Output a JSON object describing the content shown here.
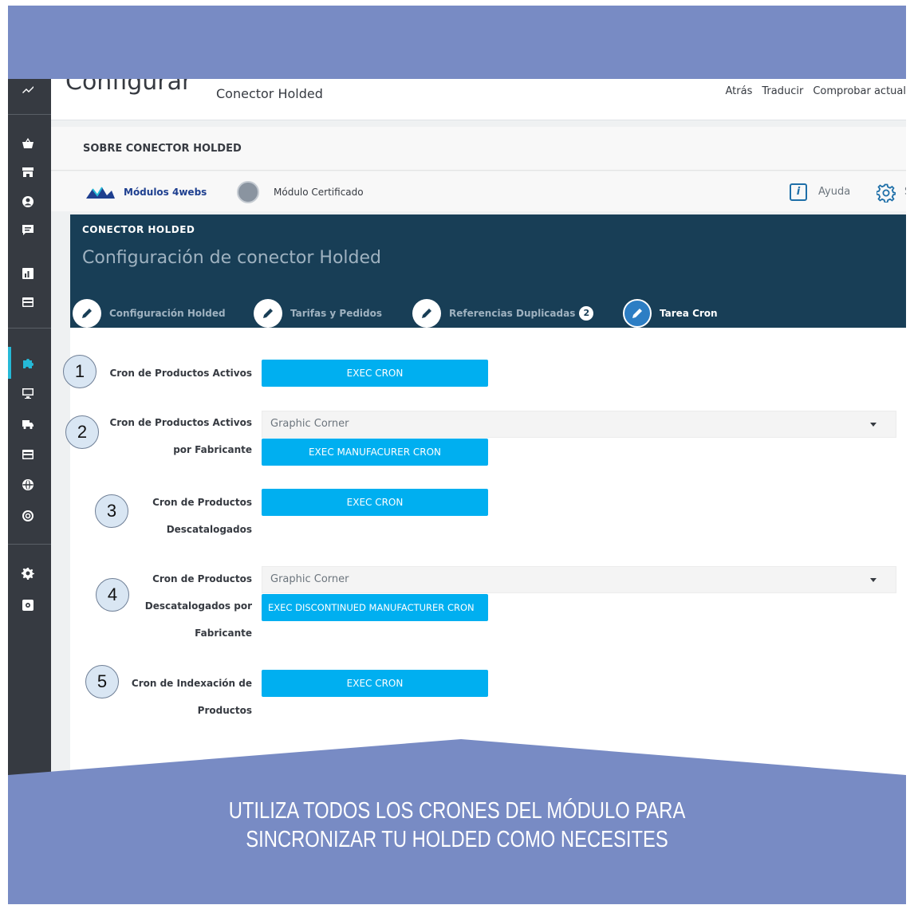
{
  "header": {
    "page_title": "Configurar",
    "module_name": "Conector Holded",
    "links": [
      "Atrás",
      "Traducir",
      "Comprobar actual"
    ]
  },
  "about": {
    "title": "SOBRE CONECTOR HOLDED"
  },
  "module_bar": {
    "brand_label": "Módulos 4webs",
    "certified_label": "Módulo Certificado",
    "help_label": "Ayuda",
    "settings_label": "S"
  },
  "panel": {
    "title": "CONECTOR HOLDED",
    "subtitle": "Configuración de conector Holded",
    "tabs": [
      {
        "label": "Configuración Holded",
        "active": false
      },
      {
        "label": "Tarifas y Pedidos",
        "active": false
      },
      {
        "label": "Referencias Duplicadas",
        "badge": "2",
        "active": false
      },
      {
        "label": "Tarea Cron",
        "active": true
      }
    ]
  },
  "form": {
    "rows": [
      {
        "number": "1",
        "label_lines": [
          "Cron de Productos Activos"
        ],
        "select": null,
        "button": "EXEC CRON"
      },
      {
        "number": "2",
        "label_lines": [
          "Cron de Productos Activos",
          "por Fabricante"
        ],
        "select": "Graphic Corner",
        "button": "EXEC MANUFACURER CRON"
      },
      {
        "number": "3",
        "label_lines": [
          "Cron de Productos",
          "Descatalogados"
        ],
        "select": null,
        "button": "EXEC CRON"
      },
      {
        "number": "4",
        "label_lines": [
          "Cron de Productos",
          "Descatalogados por",
          "Fabricante"
        ],
        "select": "Graphic Corner",
        "button": "EXEC DISCONTINUED MANUFACTURER CRON"
      },
      {
        "number": "5",
        "label_lines": [
          "Cron de Indexación de",
          "Productos"
        ],
        "select": null,
        "button": "EXEC CRON"
      }
    ]
  },
  "banner": {
    "line1": "UTILIZA TODOS LOS CRONES DEL MÓDULO PARA",
    "line2": "SINCRONIZAR TU HOLDED COMO NECESITES"
  },
  "colors": {
    "frame_bg": "#788bc4",
    "sidebar_bg": "#363a41",
    "panel_bg": "#183e56",
    "button_bg": "#00aff0",
    "active_tab": "#2d7ec4"
  },
  "sidebar_icons": [
    "stats-icon",
    "orders-basket-icon",
    "catalog-store-icon",
    "customers-icon",
    "messages-icon",
    "stats-chart-icon",
    "payment-card-icon",
    "modules-puzzle-icon",
    "design-monitor-icon",
    "shipping-truck-icon",
    "payment-card-icon-2",
    "international-globe-icon",
    "marketing-target-icon",
    "settings-gear-icon",
    "advanced-params-icon"
  ]
}
